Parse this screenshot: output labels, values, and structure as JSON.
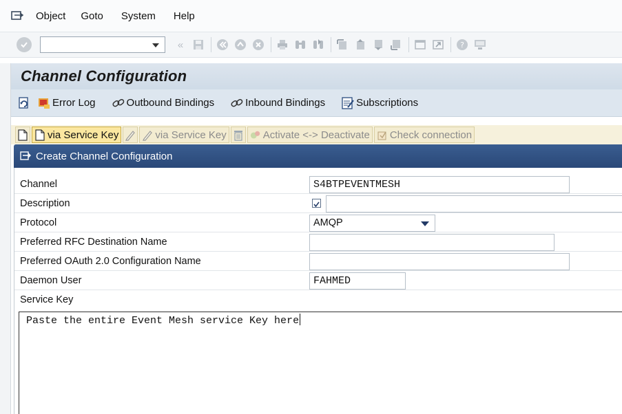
{
  "menu": {
    "items": [
      {
        "label": "Object"
      },
      {
        "label": "Goto"
      },
      {
        "label": "System"
      },
      {
        "label": "Help"
      }
    ]
  },
  "command_field": {
    "value": ""
  },
  "title": "Channel Configuration",
  "app_toolbar": {
    "error_log": "Error Log",
    "outbound_bindings": "Outbound Bindings",
    "inbound_bindings": "Inbound Bindings",
    "subscriptions": "Subscriptions"
  },
  "grid_toolbar": {
    "create_via_service_key": "via Service Key",
    "edit_via_service_key": "via Service Key",
    "activate_deactivate": "Activate <-> Deactivate",
    "check_connection": "Check connection"
  },
  "form": {
    "header": "Create Channel Configuration",
    "fields": {
      "channel": {
        "label": "Channel",
        "value": "S4BTPEVENTMESH"
      },
      "description": {
        "label": "Description",
        "value": ""
      },
      "protocol": {
        "label": "Protocol",
        "value": "AMQP"
      },
      "rfc_destination": {
        "label": "Preferred RFC Destination Name",
        "value": ""
      },
      "oauth_config": {
        "label": "Preferred OAuth 2.0 Configuration Name",
        "value": ""
      },
      "daemon_user": {
        "label": "Daemon User",
        "value": "FAHMED"
      },
      "service_key": {
        "label": "Service Key",
        "value": "Paste the entire Event Mesh service Key here"
      }
    }
  },
  "colors": {
    "form_header": "#2f5284",
    "title_bar": "#d6e0ea",
    "grid_toolbar": "#f6f1dc"
  }
}
